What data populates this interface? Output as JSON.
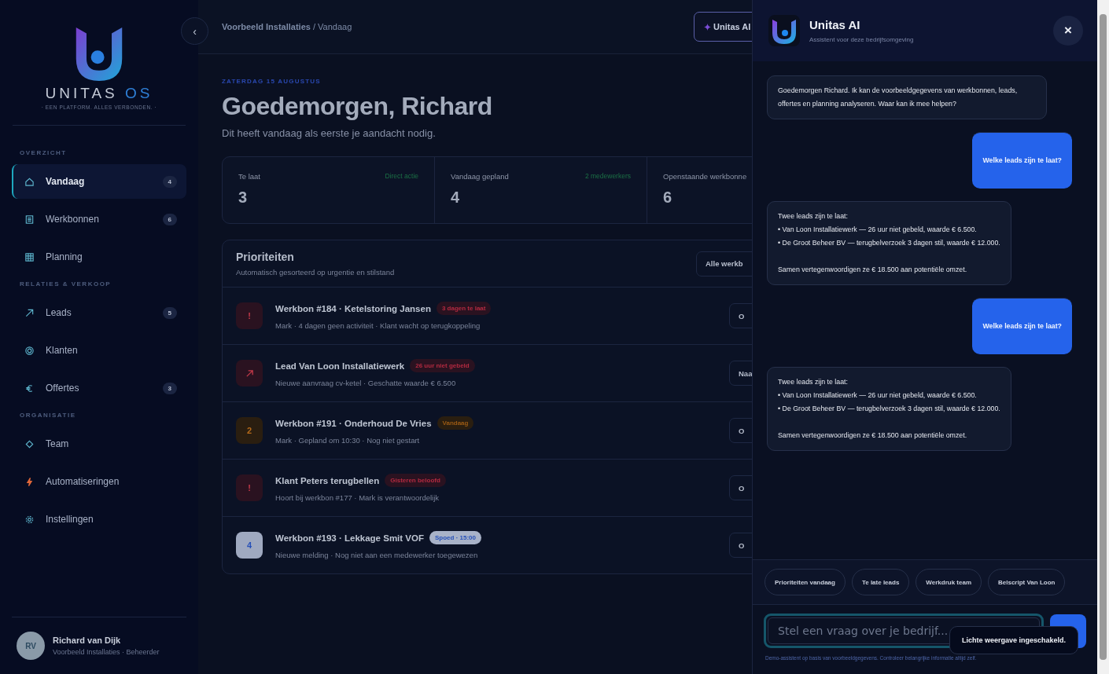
{
  "sidebar": {
    "logo": {
      "name": "UNITAS",
      "suffix": "OS",
      "tagline": "· EEN PLATFORM. ALLES VERBONDEN. ·"
    },
    "collapse_label": "‹",
    "sections": [
      {
        "title": "OVERZICHT",
        "items": [
          {
            "kind": "home",
            "label": "Vandaag",
            "badge": "4",
            "selected": true
          },
          {
            "kind": "list",
            "label": "Werkbonnen",
            "badge": "6",
            "selected": false
          },
          {
            "kind": "grid",
            "label": "Planning",
            "selected": false
          }
        ]
      },
      {
        "title": "RELATIES & VERKOOP",
        "items": [
          {
            "kind": "arrow",
            "label": "Leads",
            "badge": "5",
            "selected": false
          },
          {
            "kind": "target",
            "label": "Klanten",
            "selected": false
          },
          {
            "kind": "euro",
            "label": "Offertes",
            "badge": "3",
            "selected": false
          }
        ]
      },
      {
        "title": "ORGANISATIE",
        "items": [
          {
            "kind": "diamond",
            "label": "Team",
            "selected": false
          },
          {
            "kind": "bolt",
            "label": "Automatiseringen",
            "selected": false
          },
          {
            "kind": "gear",
            "label": "Instellingen",
            "selected": false
          }
        ]
      }
    ],
    "user": {
      "initials": "RV",
      "name": "Richard van Dijk",
      "role": "Voorbeeld Installaties · Beheerder"
    }
  },
  "header": {
    "breadcrumb": "**Voorbeeld Installaties** / Vandaag",
    "ai_button": "Unitas AI"
  },
  "greeting": {
    "date": "ZATERDAG 15 AUGUSTUS",
    "title": "Goedemorgen, Richard",
    "subtitle": "Dit heeft vandaag als eerste je aandacht nodig."
  },
  "stats": [
    {
      "label": "Te laat",
      "hint": "Direct actie",
      "value": "3"
    },
    {
      "label": "Vandaag gepland",
      "hint": "2 medewerkers",
      "value": "4"
    },
    {
      "label": "Openstaande werkbonne",
      "value": "6"
    }
  ],
  "priorities": {
    "title": "Prioriteiten",
    "subtitle": "Automatisch gesorteerd op urgentie en stilstand",
    "button": "Alle werkb",
    "rows": [
      {
        "kind": "overdue",
        "marker": "!",
        "title": "Werkbon #184 · Ketelstoring Jansen",
        "tag": "3 dagen te laat",
        "meta": "Mark · 4 dagen geen activiteit · Klant wacht op terugkoppeling",
        "action": "O"
      },
      {
        "kind": "lead",
        "title": "Lead Van Loon Installatiewerk",
        "tag": "26 uur niet gebeld",
        "meta": "Nieuwe aanvraag cv-ketel · Geschatte waarde € 6.500",
        "action": "Naa"
      },
      {
        "kind": "today",
        "marker": "2",
        "title": "Werkbon #191 · Onderhoud De Vries",
        "tag": "Vandaag",
        "meta": "Mark · Gepland om 10:30 · Nog niet gestart",
        "action": "O"
      },
      {
        "kind": "overdue",
        "marker": "!",
        "title": "Klant Peters terugbellen",
        "tag": "Gisteren beloofd",
        "meta": "Hoort bij werkbon #177 · Mark is verantwoordelijk",
        "action": "O"
      },
      {
        "kind": "urgent",
        "marker": "4",
        "title": "Werkbon #193 · Lekkage Smit VOF",
        "tag": "Spoed · 15:00",
        "meta": "Nieuwe melding · Nog niet aan een medewerker toegewezen",
        "action": "O"
      }
    ]
  },
  "chat": {
    "title": "Unitas AI",
    "subtitle": "Assistent voor deze bedrijfsomgeving",
    "close": "×",
    "messages": [
      {
        "kind": "assistant",
        "paragraphs": [
          [
            "Goedemorgen Richard. Ik kan de voorbeeldgegevens van werkbonnen, leads, offertes en planning analyseren. Waar kan ik mee helpen?"
          ]
        ]
      },
      {
        "kind": "user",
        "paragraphs": [
          [
            "Welke leads zijn te laat?"
          ]
        ]
      },
      {
        "kind": "assistant",
        "paragraphs": [
          [
            "Twee leads zijn te laat:",
            "• Van Loon Installatiewerk — 26 uur niet gebeld, waarde € 6.500.",
            "• De Groot Beheer BV — terugbelverzoek 3 dagen stil, waarde € 12.000."
          ],
          [
            "Samen vertegenwoordigen ze € 18.500 aan potentiële omzet."
          ]
        ]
      },
      {
        "kind": "user",
        "paragraphs": [
          [
            "Welke leads zijn te laat?"
          ]
        ]
      },
      {
        "kind": "assistant",
        "paragraphs": [
          [
            "Twee leads zijn te laat:",
            "• Van Loon Installatiewerk — 26 uur niet gebeld, waarde € 6.500.",
            "• De Groot Beheer BV — terugbelverzoek 3 dagen stil, waarde € 12.000."
          ],
          [
            "Samen vertegenwoordigen ze € 18.500 aan potentiële omzet."
          ]
        ]
      }
    ],
    "suggestions": [
      "Prioriteiten vandaag",
      "Te late leads",
      "Werkdruk team",
      "Belscript Van Loon"
    ],
    "input": {
      "placeholder": "Stel een vraag over je bedrijf..."
    },
    "disclaimer": "Demo-assistent op basis van voorbeeldgegevens. Controleer belangrijke informatie altijd zelf.",
    "toast": "Lichte weergave ingeschakeld."
  }
}
